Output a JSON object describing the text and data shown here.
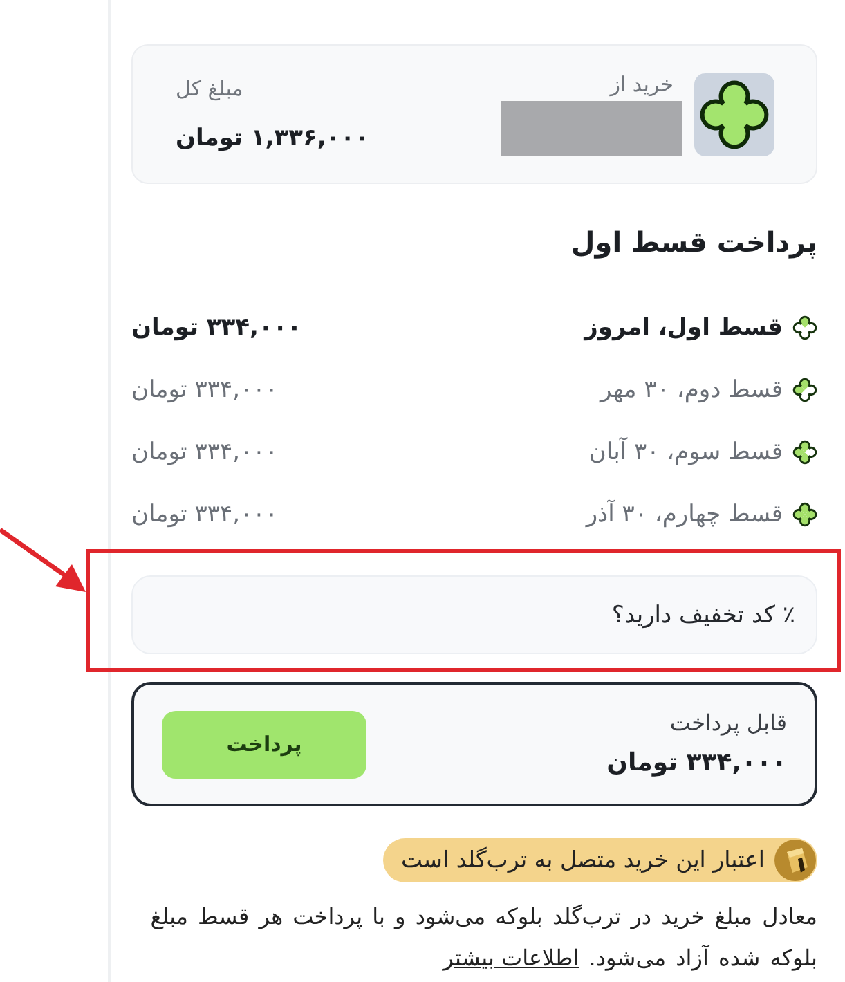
{
  "summary": {
    "merchant_label": "خرید از",
    "merchant_redacted": true,
    "total_label": "مبلغ کل",
    "total_amount": "۱,۳۳۶,۰۰۰ تومان"
  },
  "heading": "پرداخت قسط اول",
  "installments": [
    {
      "label": "قسط اول، امروز",
      "amount": "۳۳۴,۰۰۰ تومان",
      "current": true,
      "segments": [
        true,
        false,
        false,
        false
      ]
    },
    {
      "label": "قسط دوم، ۳۰ مهر",
      "amount": "۳۳۴,۰۰۰ تومان",
      "current": false,
      "segments": [
        true,
        true,
        false,
        false
      ]
    },
    {
      "label": "قسط سوم، ۳۰ آبان",
      "amount": "۳۳۴,۰۰۰ تومان",
      "current": false,
      "segments": [
        true,
        true,
        true,
        false
      ]
    },
    {
      "label": "قسط چهارم، ۳۰ آذر",
      "amount": "۳۳۴,۰۰۰ تومان",
      "current": false,
      "segments": [
        true,
        true,
        true,
        true
      ]
    }
  ],
  "discount": {
    "label": "٪ کد تخفیف دارید؟"
  },
  "payment": {
    "label": "قابل پرداخت",
    "amount": "۳۳۴,۰۰۰ تومان",
    "button": "پرداخت"
  },
  "credit_badge": {
    "text": "اعتبار این خرید متصل به ترب‌گلد است"
  },
  "note": {
    "text": "معادل مبلغ خرید در ترب‌گلد بلوکه می‌شود و با پرداخت هر قسط مبلغ بلوکه شده آزاد می‌شود.",
    "link": "اطلاعات بیشتر"
  },
  "annotation": {
    "highlight": true,
    "arrow": true
  }
}
